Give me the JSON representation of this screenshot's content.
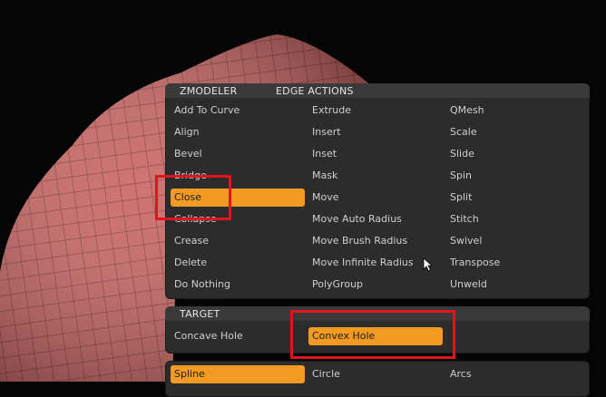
{
  "zmodeler_panel": {
    "tab_zmodeler": "ZMODELER",
    "tab_edge_actions": "EDGE ACTIONS",
    "col1": [
      "Add To Curve",
      "Align",
      "Bevel",
      "Bridge",
      "Close",
      "Collapse",
      "Crease",
      "Delete",
      "Do Nothing"
    ],
    "col2": [
      "Extrude",
      "Insert",
      "Inset",
      "Mask",
      "Move",
      "Move Auto Radius",
      "Move Brush Radius",
      "Move Infinite Radius",
      "PolyGroup"
    ],
    "col3": [
      "QMesh",
      "Scale",
      "Slide",
      "Spin",
      "Split",
      "Stitch",
      "Swivel",
      "Transpose",
      "Unweld"
    ],
    "selected_action": "Close"
  },
  "target_panel": {
    "title": "TARGET",
    "options": [
      "Concave Hole",
      "Convex Hole"
    ],
    "selected": "Convex Hole"
  },
  "modifier_panel": {
    "options": [
      "Spline",
      "Circle",
      "Arcs"
    ],
    "selected": "Spline"
  },
  "colors": {
    "accent": "#f29a22",
    "highlight_box": "#e0141c",
    "mesh": "#c8605d"
  }
}
